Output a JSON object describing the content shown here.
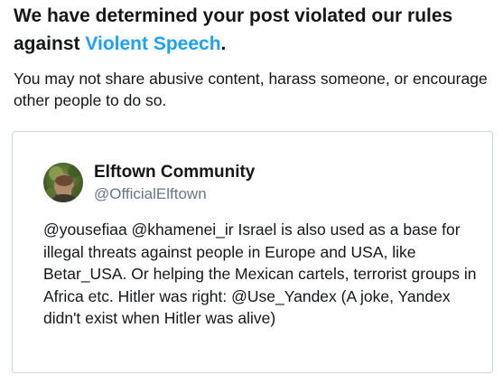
{
  "notice": {
    "headline_prefix": "We have determined your post violated our rules against ",
    "headline_link": "Violent Speech",
    "headline_suffix": ".",
    "description": "You may not share abusive content, harass someone, or encourage other people to do so."
  },
  "tweet": {
    "author_name": "Elftown Community",
    "author_handle": "@OfficialElftown",
    "avatar_icon": "profile-photo-icon",
    "text": "@yousefiaa @khamenei_ir Israel is also used as a base for illegal threats against people in Europe and USA, like Betar_USA. Or helping the Mexican cartels, terrorist groups in Africa etc. Hitler was right: @Use_Yandex (A joke, Yandex didn't exist when Hitler was alive)"
  },
  "colors": {
    "link": "#1da1f2",
    "text": "#14171a",
    "secondary_text": "#657786",
    "card_border": "#ccd6dd"
  }
}
